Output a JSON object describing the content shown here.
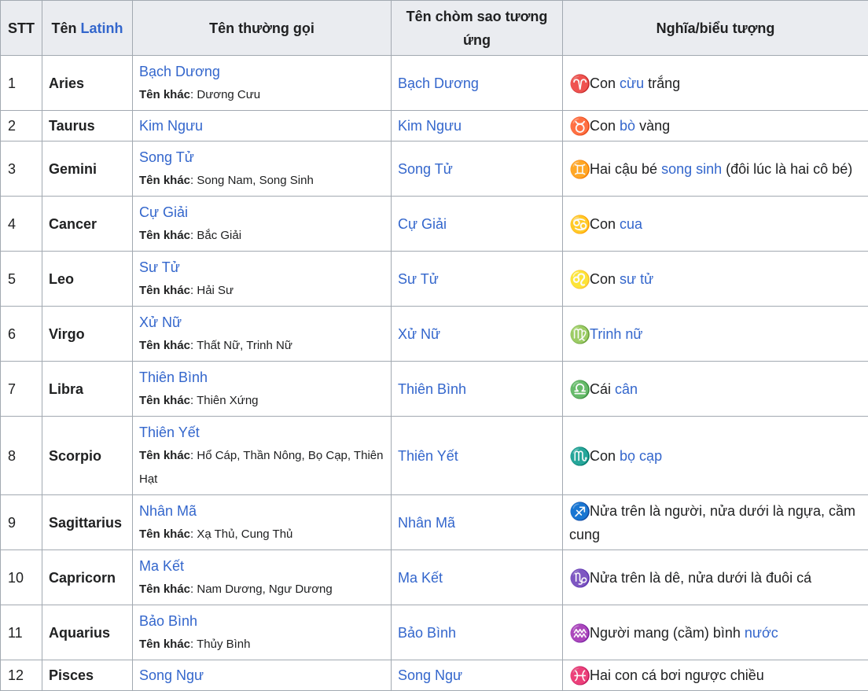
{
  "headers": {
    "stt": "STT",
    "latin_prefix": "Tên ",
    "latin_link": "Latinh",
    "common": "Tên thường gọi",
    "constellation": "Tên chòm sao tương ứng",
    "meaning": "Nghĩa/biểu tượng"
  },
  "alt_label": "Tên khác",
  "rows": [
    {
      "stt": "1",
      "latin": "Aries",
      "common": "Bạch Dương",
      "alt": ": Dương Cưu",
      "constellation": "Bạch Dương",
      "symbol": "♈",
      "meaning": [
        {
          "t": "Con "
        },
        {
          "t": "cừu",
          "link": true
        },
        {
          "t": " trắng"
        }
      ]
    },
    {
      "stt": "2",
      "latin": "Taurus",
      "common": "Kim Ngưu",
      "alt": "",
      "constellation": "Kim Ngưu",
      "symbol": "♉",
      "meaning": [
        {
          "t": "Con "
        },
        {
          "t": "bò",
          "link": true
        },
        {
          "t": " vàng"
        }
      ]
    },
    {
      "stt": "3",
      "latin": "Gemini",
      "common": "Song Tử",
      "alt": ": Song Nam, Song Sinh",
      "constellation": "Song Tử",
      "symbol": "♊",
      "meaning": [
        {
          "t": "Hai cậu bé "
        },
        {
          "t": "song sinh",
          "link": true
        },
        {
          "t": " (đôi lúc là hai cô bé)"
        }
      ]
    },
    {
      "stt": "4",
      "latin": "Cancer",
      "common": "Cự Giải",
      "alt": ": Bắc Giải",
      "constellation": "Cự Giải",
      "symbol": "♋",
      "meaning": [
        {
          "t": "Con "
        },
        {
          "t": "cua",
          "link": true
        }
      ]
    },
    {
      "stt": "5",
      "latin": "Leo",
      "common": "Sư Tử",
      "alt": ": Hải Sư",
      "constellation": "Sư Tử",
      "symbol": "♌",
      "meaning": [
        {
          "t": "Con "
        },
        {
          "t": "sư tử",
          "link": true
        }
      ]
    },
    {
      "stt": "6",
      "latin": "Virgo",
      "common": "Xử Nữ",
      "alt": ": Thất Nữ, Trinh Nữ",
      "constellation": "Xử Nữ",
      "symbol": "♍",
      "meaning": [
        {
          "t": "Trinh nữ",
          "link": true
        }
      ]
    },
    {
      "stt": "7",
      "latin": "Libra",
      "common": "Thiên Bình",
      "alt": ": Thiên Xứng",
      "constellation": "Thiên Bình",
      "symbol": "♎",
      "meaning": [
        {
          "t": "Cái "
        },
        {
          "t": "cân",
          "link": true
        }
      ]
    },
    {
      "stt": "8",
      "latin": "Scorpio",
      "common": "Thiên Yết",
      "alt": ": Hổ Cáp, Thần Nông, Bọ Cạp, Thiên Hạt",
      "constellation": "Thiên Yết",
      "symbol": "♏",
      "meaning": [
        {
          "t": "Con "
        },
        {
          "t": "bọ cạp",
          "link": true
        }
      ]
    },
    {
      "stt": "9",
      "latin": "Sagittarius",
      "common": "Nhân Mã",
      "alt": ": Xạ Thủ, Cung Thủ",
      "constellation": "Nhân Mã",
      "symbol": "♐",
      "meaning": [
        {
          "t": "Nửa trên là người, nửa dưới là ngựa, cầm cung"
        }
      ]
    },
    {
      "stt": "10",
      "latin": "Capricorn",
      "common": "Ma Kết",
      "alt": ": Nam Dương, Ngư Dương",
      "constellation": "Ma Kết",
      "symbol": "♑",
      "meaning": [
        {
          "t": "Nửa trên là dê, nửa dưới là đuôi cá"
        }
      ]
    },
    {
      "stt": "11",
      "latin": "Aquarius",
      "common": "Bảo Bình",
      "alt": ": Thủy Bình",
      "constellation": "Bảo Bình",
      "symbol": "♒",
      "meaning": [
        {
          "t": "Người mang (cầm) bình "
        },
        {
          "t": "nước",
          "link": true
        }
      ]
    },
    {
      "stt": "12",
      "latin": "Pisces",
      "common": "Song Ngư",
      "alt": "",
      "constellation": "Song Ngư",
      "symbol": "♓",
      "meaning": [
        {
          "t": "Hai con cá bơi ngược chiều"
        }
      ]
    }
  ]
}
